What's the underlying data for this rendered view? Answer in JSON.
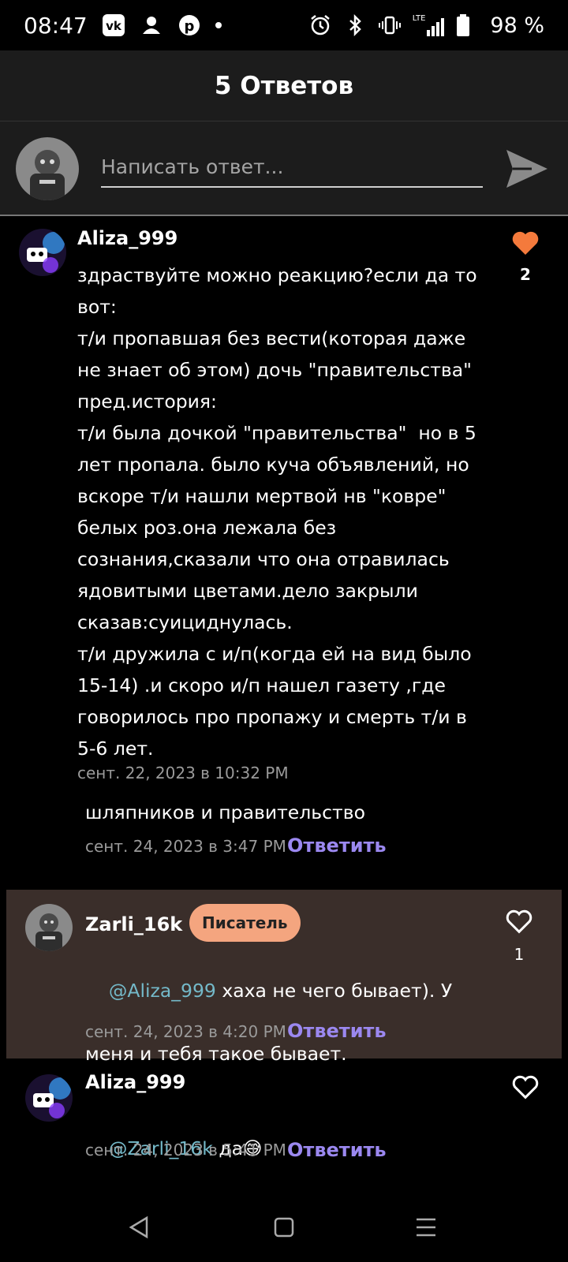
{
  "statusbar": {
    "time": "08:47",
    "network": "LTE",
    "battery": "98 %"
  },
  "header": {
    "title": "5 Ответов"
  },
  "compose": {
    "placeholder": "Написать ответ..."
  },
  "comments": [
    {
      "username": "Aliza_999",
      "text": "здраствуйте можно реакцию?если да то\nвот:\nт/и пропавшая без вести(которая даже\nне знает об этом) дочь \"правительства\"\nпред.история:\nт/и была дочкой \"правительства\"  но в 5\nлет пропала. было куча объявлений, но\nвскоре т/и нашли мертвой нв \"ковре\"\nбелых роз.она лежала без\nсознания,сказали что она отравилась\nядовитыми цветами.дело закрыли\nсказав:суициднулась.\nт/и дружила с и/п(когда ей на вид было\n15-14) .и скоро и/п нашел газету ,где\nговорилось про пропажу и смерть т/и в\n5-6 лет.",
      "timestamp": "сент. 22, 2023 в 10:32 PM",
      "likes": "2",
      "liked": true
    },
    {
      "text": "шляпников и правительство",
      "timestamp": "сент. 24, 2023 в 3:47 PM",
      "reply_label": "Ответить"
    },
    {
      "username": "Zarli_16k",
      "badge": "Писатель",
      "mention": "@Aliza_999",
      "text_line1": " хаха не чего бывает). У",
      "text_line2": "меня и тебя такое бывает.",
      "timestamp": "сент. 24, 2023 в 4:20 PM",
      "reply_label": "Ответить",
      "likes": "1",
      "liked": false
    },
    {
      "username": "Aliza_999",
      "mention": "@Zarli_16k",
      "text": " да😅",
      "timestamp": "сент. 24, 2023 в 5:41 PM",
      "reply_label": "Ответить",
      "liked": false
    }
  ],
  "colors": {
    "accent_like": "#f47a3c",
    "reply_link": "#9b88f0",
    "mention": "#74b9c9",
    "badge": "#f4a57f",
    "highlight_bg": "#3a2e2a"
  }
}
